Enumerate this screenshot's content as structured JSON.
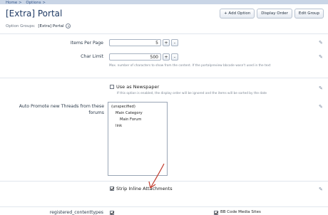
{
  "breadcrumb": [
    "Home >",
    "Options >"
  ],
  "page_title": "[Extra] Portal",
  "actions": [
    "+ Add Option",
    "Display Order",
    "Edit Group"
  ],
  "option_groups": {
    "label": "Option Groups:",
    "value": "[Extra] Portal"
  },
  "items_per_page": {
    "label": "Items Per Page",
    "value": "5",
    "plus": "+",
    "minus": "-"
  },
  "char_limit": {
    "label": "Char Limit",
    "value": "500",
    "plus": "+",
    "minus": "-",
    "hint": "Max. number of characters to show from the content. If the portalpreview bbcode wasn't used in the text"
  },
  "newspaper": {
    "label": "Use as Newspaper",
    "hint": "If this option is enabled, the display order will be ignored and the items will be sorted by the date",
    "checked": false
  },
  "auto_promote": {
    "label": "Auto Promote new Threads from these forums",
    "options": [
      "(unspecified)",
      "Main Category",
      "Main Forum",
      "link"
    ]
  },
  "strip_inline": {
    "label": "Strip Inline Attachments",
    "checked": true
  },
  "bottom_row": {
    "left_label": "registered_contenttypes",
    "right_label": "BB Code Media Sites"
  },
  "colors": {
    "accent": "#1f3a64",
    "arrow": "#c0392b"
  },
  "icons": [
    "edit-icon",
    "chevron-down-icon",
    "checkbox-icon"
  ]
}
